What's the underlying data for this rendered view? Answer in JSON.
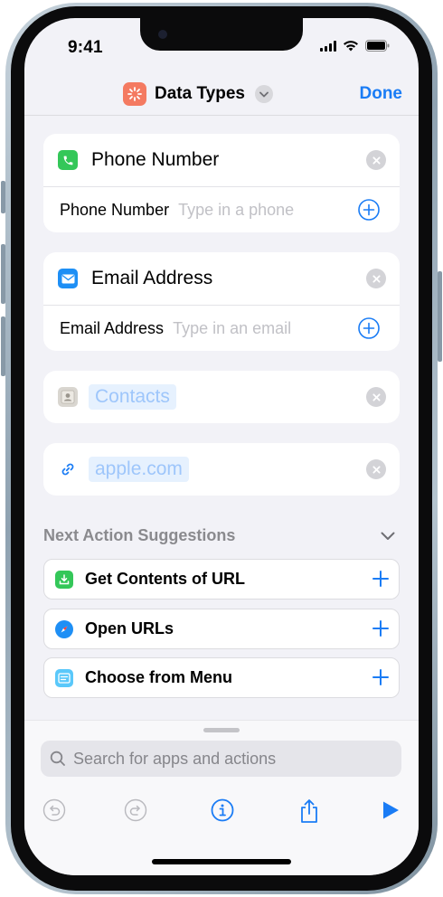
{
  "status_bar": {
    "time": "9:41"
  },
  "header": {
    "title": "Data Types",
    "done_label": "Done"
  },
  "cards": {
    "phone": {
      "title": "Phone Number",
      "field_label": "Phone Number",
      "placeholder": "Type in a phone"
    },
    "email": {
      "title": "Email Address",
      "field_label": "Email Address",
      "placeholder": "Type in an email"
    },
    "contacts": {
      "token": "Contacts"
    },
    "url": {
      "token": "apple.com"
    }
  },
  "suggestions": {
    "title": "Next Action Suggestions",
    "items": [
      {
        "label": "Get Contents of URL",
        "icon": "download-icon"
      },
      {
        "label": "Open URLs",
        "icon": "safari-icon"
      },
      {
        "label": "Choose from Menu",
        "icon": "menu-icon"
      }
    ]
  },
  "search": {
    "placeholder": "Search for apps and actions"
  },
  "colors": {
    "accent": "#1a7cf5",
    "app_icon": "#f47a61",
    "phone_green": "#34c759"
  }
}
